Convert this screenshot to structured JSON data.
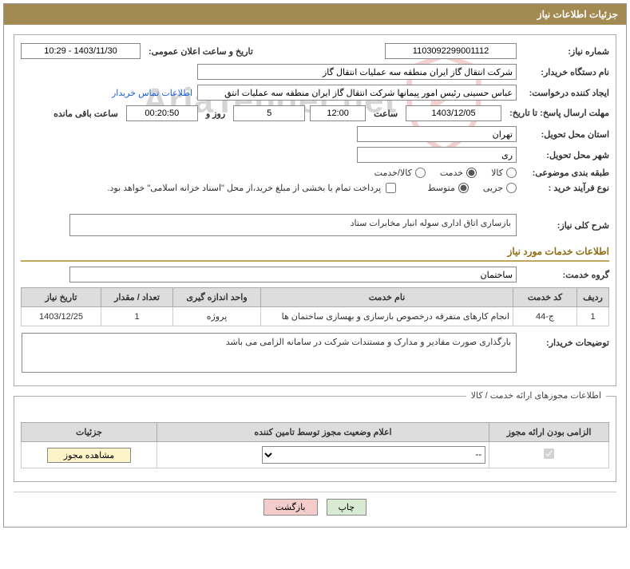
{
  "header": {
    "title": "جزئیات اطلاعات نیاز"
  },
  "need_number": {
    "label": "شماره نیاز:",
    "value": "1103092299001112"
  },
  "announce_datetime": {
    "label": "تاریخ و ساعت اعلان عمومی:",
    "value": "1403/11/30 - 10:29"
  },
  "buyer_org": {
    "label": "نام دستگاه خریدار:",
    "value": "شرکت انتقال گاز ایران منطقه سه عملیات انتقال گاز"
  },
  "requester": {
    "label": "ایجاد کننده درخواست:",
    "value": "عباس حسینی رئیس امور پیمانها شرکت انتقال گاز ایران منطقه سه عملیات انتق",
    "contact_link": "اطلاعات تماس خریدار"
  },
  "deadline": {
    "label": "مهلت ارسال پاسخ: تا تاریخ:",
    "date": "1403/12/05",
    "time_label": "ساعت",
    "time": "12:00",
    "days": "5",
    "days_label": "روز و",
    "remaining": "00:20:50",
    "remaining_label": "ساعت باقی مانده"
  },
  "province": {
    "label": "استان محل تحویل:",
    "value": "تهران"
  },
  "city": {
    "label": "شهر محل تحویل:",
    "value": "ری"
  },
  "subject_class": {
    "label": "طبقه بندی موضوعی:",
    "options": {
      "goods": "کالا",
      "service": "خدمت",
      "goods_service": "کالا/خدمت"
    },
    "selected": "service"
  },
  "purchase_type": {
    "label": "نوع فرآیند خرید :",
    "options": {
      "minor": "جزیی",
      "medium": "متوسط"
    },
    "selected": "medium",
    "note": "پرداخت تمام یا بخشی از مبلغ خرید،از محل \"اسناد خزانه اسلامی\" خواهد بود."
  },
  "need_desc": {
    "label": "شرح کلی نیاز:",
    "value": "بازسازی اتاق اداری سوله انبار مخابرات ستاد"
  },
  "service_info_title": "اطلاعات خدمات مورد نیاز",
  "service_group": {
    "label": "گروه خدمت:",
    "value": "ساختمان"
  },
  "service_table": {
    "headers": {
      "row": "ردیف",
      "code": "کد خدمت",
      "name": "نام خدمت",
      "unit": "واحد اندازه گیری",
      "qty": "تعداد / مقدار",
      "date": "تاریخ نیاز"
    },
    "rows": [
      {
        "row": "1",
        "code": "ج-44",
        "name": "انجام کارهای متفرقه درخصوص بازسازی و بهسازی ساختمان ها",
        "unit": "پروژه",
        "qty": "1",
        "date": "1403/12/25"
      }
    ]
  },
  "buyer_notes": {
    "label": "توضیحات خریدار:",
    "value": "بارگذاری صورت مقادیر و مدارک و مستندات شرکت در سامانه الزامی می باشد"
  },
  "license_panel": {
    "legend": "اطلاعات مجوزهای ارائه خدمت / کالا",
    "headers": {
      "mandatory": "الزامی بودن ارائه مجوز",
      "status": "اعلام وضعیت مجوز توسط تامین کننده",
      "details": "جزئیات"
    },
    "row": {
      "status_selected": "--",
      "view_btn": "مشاهده مجوز"
    }
  },
  "buttons": {
    "print": "چاپ",
    "back": "بازگشت"
  },
  "watermark": "AriaTender.net"
}
